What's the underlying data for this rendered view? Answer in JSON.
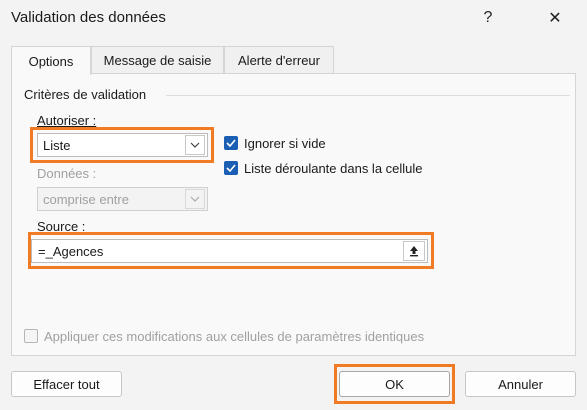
{
  "window": {
    "title": "Validation des données",
    "help_label": "?",
    "close_label": "✕"
  },
  "tabs": [
    {
      "label": "Options",
      "active": true
    },
    {
      "label": "Message de saisie",
      "active": false
    },
    {
      "label": "Alerte d'erreur",
      "active": false
    }
  ],
  "criteria": {
    "group_title": "Critères de validation",
    "allow_label": "Autoriser :",
    "allow_value": "Liste",
    "data_label": "Données :",
    "data_value": "comprise entre",
    "ignore_blank_label": "Ignorer si vide",
    "ignore_blank_checked": true,
    "dropdown_label": "Liste déroulante dans la cellule",
    "dropdown_checked": true,
    "source_label": "Source :",
    "source_value": "=_Agences"
  },
  "apply_all": {
    "label": "Appliquer ces modifications aux cellules de paramètres identiques",
    "checked": false
  },
  "buttons": {
    "clear_all": "Effacer tout",
    "ok": "OK",
    "cancel": "Annuler"
  },
  "colors": {
    "highlight": "#f07b24",
    "checkbox_accent": "#1a5fb4"
  },
  "icons": {
    "dropdown": "chevron-down-icon",
    "collapse": "upload-arrow-icon",
    "check": "checkmark-icon"
  }
}
